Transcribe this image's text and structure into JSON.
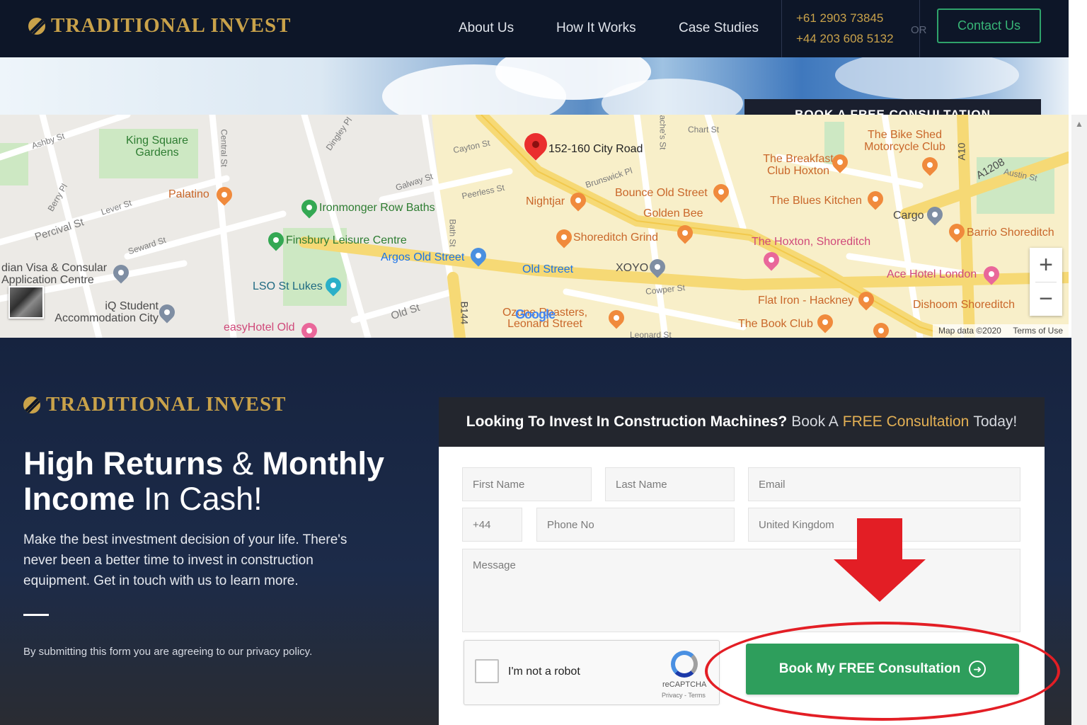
{
  "header": {
    "logo_text": "TRADITIONAL INVEST",
    "nav": [
      "About Us",
      "How It Works",
      "Case Studies"
    ],
    "phone_au": "+61 2903 73845",
    "phone_uk": "+44 203 608 5132",
    "or_text": "OR",
    "contact_label": "Contact Us"
  },
  "banner": {
    "book_tab": "BOOK A FREE CONSULTATION"
  },
  "map": {
    "address_label": "152-160 City Road",
    "places": {
      "king_square": "King Square Gardens",
      "palatino": "Palatino",
      "ironmonger": "Ironmonger Row Baths",
      "finsbury": "Finsbury Leisure Centre",
      "argos": "Argos Old Street",
      "visa_centre": "dian Visa & Consular Application Centre",
      "lso": "LSO St Lukes",
      "iq_student": "iQ Student Accommodation City",
      "easyhotel": "easyHotel Old",
      "nightjar": "Nightjar",
      "bounce": "Bounce Old Street",
      "golden_bee": "Golden Bee",
      "shoreditch_grind": "Shoreditch Grind",
      "old_street": "Old Street",
      "xoyo": "XOYO",
      "ozone": "Ozone Roasters, Leonard Street",
      "breakfast_club": "The Breakfast Club Hoxton",
      "bike_shed": "The Bike Shed Motorcycle Club",
      "blues_kitchen": "The Blues Kitchen",
      "cargo": "Cargo",
      "hoxton": "The Hoxton, Shoreditch",
      "barrio": "Barrio Shoreditch",
      "ace_hotel": "Ace Hotel London",
      "flat_iron": "Flat Iron - Hackney",
      "dishoom": "Dishoom Shoreditch",
      "book_club": "The Book Club"
    },
    "streets": [
      "Ashby St",
      "Percival St",
      "Lever St",
      "Seward St",
      "Galway St",
      "Peerless St",
      "Cayton St",
      "Brunswick Pl",
      "Old St",
      "Bath St",
      "Chart St",
      "Cowper St",
      "Leonard St",
      "Austin St",
      "Berry Pl",
      "Central St",
      "Bache's St",
      "Dingley Pl",
      "B144",
      "A10",
      "A1208"
    ],
    "zoom_in": "+",
    "zoom_out": "−",
    "attribution": "Map data ©2020",
    "terms": "Terms of Use",
    "google": "Google"
  },
  "hero": {
    "logo_text": "TRADITIONAL INVEST",
    "title_bold_1": "High Returns",
    "title_light_1": " & ",
    "title_bold_2": "Monthly Income",
    "title_light_2": " In Cash!",
    "description": "Make the best investment decision of your life. There's never been a better time to invest in construction equipment. Get in touch with us to learn more.",
    "privacy": "By submitting this form you are agreeing to our privacy policy."
  },
  "form": {
    "heading_bold": "Looking To Invest In Construction Machines?",
    "heading_soft": "Book A",
    "heading_gold": "FREE Consultation",
    "heading_end": "Today!",
    "first_name": "First Name",
    "last_name": "Last Name",
    "email": "Email",
    "country_code": "+44",
    "phone": "Phone No",
    "country": "United Kingdom",
    "message": "Message",
    "captcha_label": "I'm not a robot",
    "captcha_brand": "reCAPTCHA",
    "captcha_terms": "Privacy - Terms",
    "submit_label": "Book My FREE Consultation"
  },
  "colors": {
    "header_bg": "#0d1628",
    "gold": "#c9a24a",
    "green": "#2e9e5c",
    "annotation_red": "#e31e25"
  },
  "icons": [
    "logo-mark-icon",
    "map-pin-icon",
    "arrow-circle-right-icon",
    "recaptcha-icon",
    "down-arrow-annotation-icon"
  ]
}
